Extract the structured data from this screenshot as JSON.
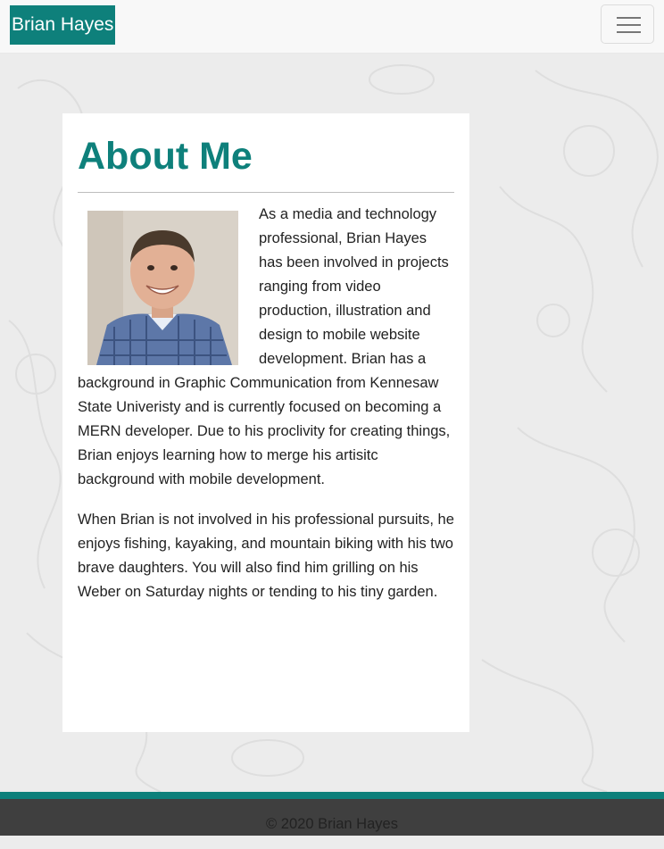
{
  "navbar": {
    "brand": "Brian Hayes",
    "menu_icon": "hamburger-icon"
  },
  "about": {
    "title": "About Me",
    "photo_icon": "profile-photo",
    "paragraph1": "As a media and technology professional, Brian Hayes has been involved in projects ranging from video production, illustration and design to mobile website development. Brian has a background in Graphic Communication from Kennesaw State Univeristy and is currently focused on becoming a MERN developer. Due to his proclivity for creating things, Brian enjoys learning how to merge his artisitc background with mobile development.",
    "paragraph2": "When Brian is not involved in his professional pursuits, he enjoys fishing, kayaking, and mountain biking with his two brave daughters. You will also find him grilling on his Weber on Saturday nights or tending to his tiny garden."
  },
  "footer": {
    "copyright": "© 2020 Brian Hayes"
  },
  "colors": {
    "accent": "#0e807b",
    "footer_bg": "#3f3f3f",
    "page_bg": "#ececec"
  }
}
